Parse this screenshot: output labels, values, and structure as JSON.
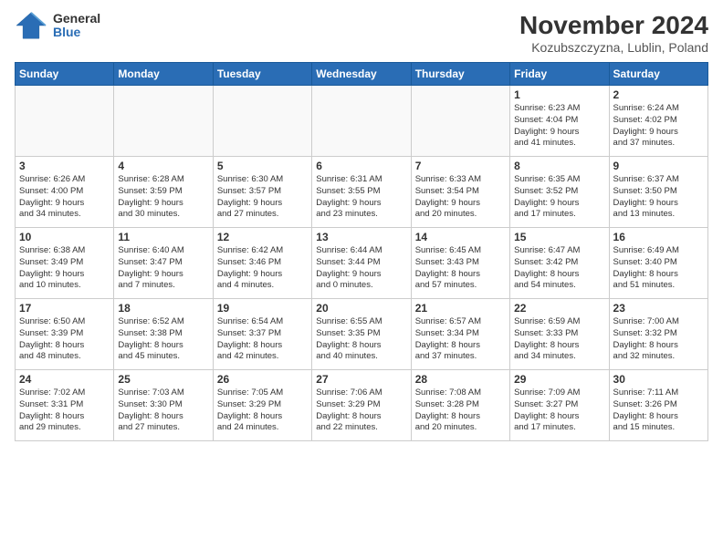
{
  "logo": {
    "general": "General",
    "blue": "Blue"
  },
  "title": "November 2024",
  "subtitle": "Kozubszczyzna, Lublin, Poland",
  "days_of_week": [
    "Sunday",
    "Monday",
    "Tuesday",
    "Wednesday",
    "Thursday",
    "Friday",
    "Saturday"
  ],
  "weeks": [
    [
      {
        "day": "",
        "info": ""
      },
      {
        "day": "",
        "info": ""
      },
      {
        "day": "",
        "info": ""
      },
      {
        "day": "",
        "info": ""
      },
      {
        "day": "",
        "info": ""
      },
      {
        "day": "1",
        "info": "Sunrise: 6:23 AM\nSunset: 4:04 PM\nDaylight: 9 hours\nand 41 minutes."
      },
      {
        "day": "2",
        "info": "Sunrise: 6:24 AM\nSunset: 4:02 PM\nDaylight: 9 hours\nand 37 minutes."
      }
    ],
    [
      {
        "day": "3",
        "info": "Sunrise: 6:26 AM\nSunset: 4:00 PM\nDaylight: 9 hours\nand 34 minutes."
      },
      {
        "day": "4",
        "info": "Sunrise: 6:28 AM\nSunset: 3:59 PM\nDaylight: 9 hours\nand 30 minutes."
      },
      {
        "day": "5",
        "info": "Sunrise: 6:30 AM\nSunset: 3:57 PM\nDaylight: 9 hours\nand 27 minutes."
      },
      {
        "day": "6",
        "info": "Sunrise: 6:31 AM\nSunset: 3:55 PM\nDaylight: 9 hours\nand 23 minutes."
      },
      {
        "day": "7",
        "info": "Sunrise: 6:33 AM\nSunset: 3:54 PM\nDaylight: 9 hours\nand 20 minutes."
      },
      {
        "day": "8",
        "info": "Sunrise: 6:35 AM\nSunset: 3:52 PM\nDaylight: 9 hours\nand 17 minutes."
      },
      {
        "day": "9",
        "info": "Sunrise: 6:37 AM\nSunset: 3:50 PM\nDaylight: 9 hours\nand 13 minutes."
      }
    ],
    [
      {
        "day": "10",
        "info": "Sunrise: 6:38 AM\nSunset: 3:49 PM\nDaylight: 9 hours\nand 10 minutes."
      },
      {
        "day": "11",
        "info": "Sunrise: 6:40 AM\nSunset: 3:47 PM\nDaylight: 9 hours\nand 7 minutes."
      },
      {
        "day": "12",
        "info": "Sunrise: 6:42 AM\nSunset: 3:46 PM\nDaylight: 9 hours\nand 4 minutes."
      },
      {
        "day": "13",
        "info": "Sunrise: 6:44 AM\nSunset: 3:44 PM\nDaylight: 9 hours\nand 0 minutes."
      },
      {
        "day": "14",
        "info": "Sunrise: 6:45 AM\nSunset: 3:43 PM\nDaylight: 8 hours\nand 57 minutes."
      },
      {
        "day": "15",
        "info": "Sunrise: 6:47 AM\nSunset: 3:42 PM\nDaylight: 8 hours\nand 54 minutes."
      },
      {
        "day": "16",
        "info": "Sunrise: 6:49 AM\nSunset: 3:40 PM\nDaylight: 8 hours\nand 51 minutes."
      }
    ],
    [
      {
        "day": "17",
        "info": "Sunrise: 6:50 AM\nSunset: 3:39 PM\nDaylight: 8 hours\nand 48 minutes."
      },
      {
        "day": "18",
        "info": "Sunrise: 6:52 AM\nSunset: 3:38 PM\nDaylight: 8 hours\nand 45 minutes."
      },
      {
        "day": "19",
        "info": "Sunrise: 6:54 AM\nSunset: 3:37 PM\nDaylight: 8 hours\nand 42 minutes."
      },
      {
        "day": "20",
        "info": "Sunrise: 6:55 AM\nSunset: 3:35 PM\nDaylight: 8 hours\nand 40 minutes."
      },
      {
        "day": "21",
        "info": "Sunrise: 6:57 AM\nSunset: 3:34 PM\nDaylight: 8 hours\nand 37 minutes."
      },
      {
        "day": "22",
        "info": "Sunrise: 6:59 AM\nSunset: 3:33 PM\nDaylight: 8 hours\nand 34 minutes."
      },
      {
        "day": "23",
        "info": "Sunrise: 7:00 AM\nSunset: 3:32 PM\nDaylight: 8 hours\nand 32 minutes."
      }
    ],
    [
      {
        "day": "24",
        "info": "Sunrise: 7:02 AM\nSunset: 3:31 PM\nDaylight: 8 hours\nand 29 minutes."
      },
      {
        "day": "25",
        "info": "Sunrise: 7:03 AM\nSunset: 3:30 PM\nDaylight: 8 hours\nand 27 minutes."
      },
      {
        "day": "26",
        "info": "Sunrise: 7:05 AM\nSunset: 3:29 PM\nDaylight: 8 hours\nand 24 minutes."
      },
      {
        "day": "27",
        "info": "Sunrise: 7:06 AM\nSunset: 3:29 PM\nDaylight: 8 hours\nand 22 minutes."
      },
      {
        "day": "28",
        "info": "Sunrise: 7:08 AM\nSunset: 3:28 PM\nDaylight: 8 hours\nand 20 minutes."
      },
      {
        "day": "29",
        "info": "Sunrise: 7:09 AM\nSunset: 3:27 PM\nDaylight: 8 hours\nand 17 minutes."
      },
      {
        "day": "30",
        "info": "Sunrise: 7:11 AM\nSunset: 3:26 PM\nDaylight: 8 hours\nand 15 minutes."
      }
    ]
  ]
}
